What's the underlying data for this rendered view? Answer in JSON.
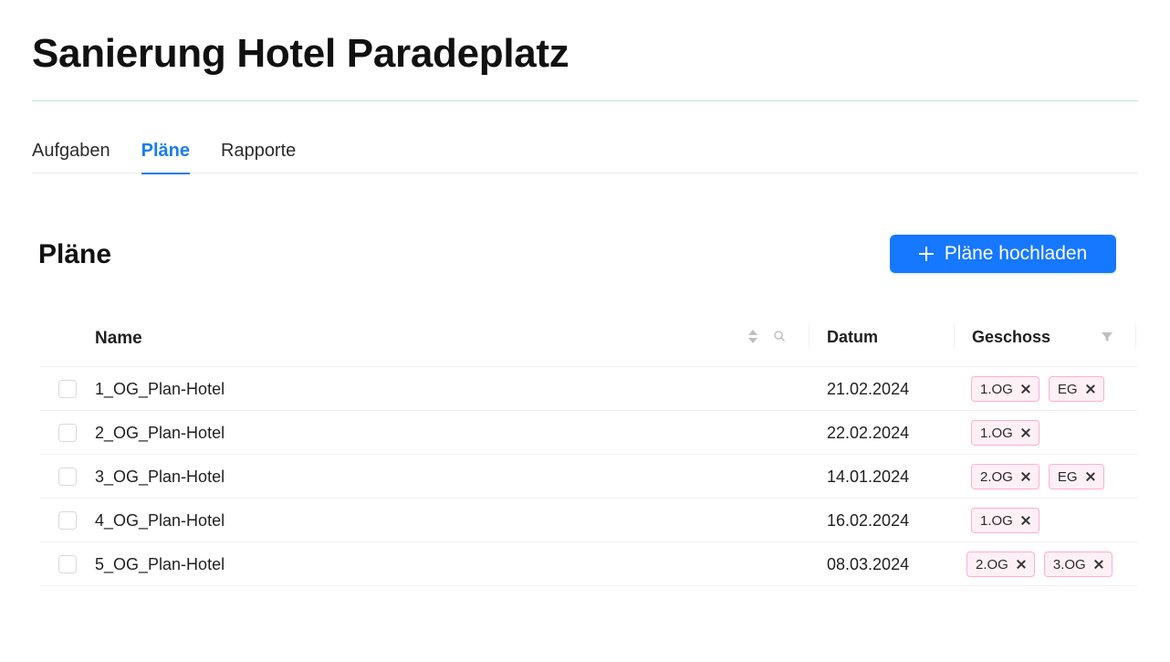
{
  "project": {
    "title": "Sanierung Hotel Paradeplatz"
  },
  "tabs": [
    {
      "label": "Aufgaben",
      "active": false
    },
    {
      "label": "Pläne",
      "active": true
    },
    {
      "label": "Rapporte",
      "active": false
    }
  ],
  "section": {
    "title": "Pläne"
  },
  "upload_button": {
    "label": "Pläne hochladen",
    "icon": "plus-icon"
  },
  "table": {
    "columns": {
      "name": "Name",
      "date": "Datum",
      "floor": "Geschoss"
    },
    "header_icons": [
      "sort-icon",
      "search-icon",
      "filter-icon"
    ],
    "rows": [
      {
        "name": "1_OG_Plan-Hotel",
        "date": "21.02.2024",
        "tags": [
          "1.OG",
          "EG"
        ]
      },
      {
        "name": "2_OG_Plan-Hotel",
        "date": "22.02.2024",
        "tags": [
          "1.OG"
        ]
      },
      {
        "name": "3_OG_Plan-Hotel",
        "date": "14.01.2024",
        "tags": [
          "2.OG",
          "EG"
        ]
      },
      {
        "name": "4_OG_Plan-Hotel",
        "date": "16.02.2024",
        "tags": [
          "1.OG"
        ]
      },
      {
        "name": "5_OG_Plan-Hotel",
        "date": "08.03.2024",
        "tags": [
          "2.OG",
          "3.OG"
        ]
      }
    ]
  },
  "colors": {
    "accent": "#1677ff",
    "tag_border": "#ffadd2",
    "tag_background": "#fff0f6"
  }
}
